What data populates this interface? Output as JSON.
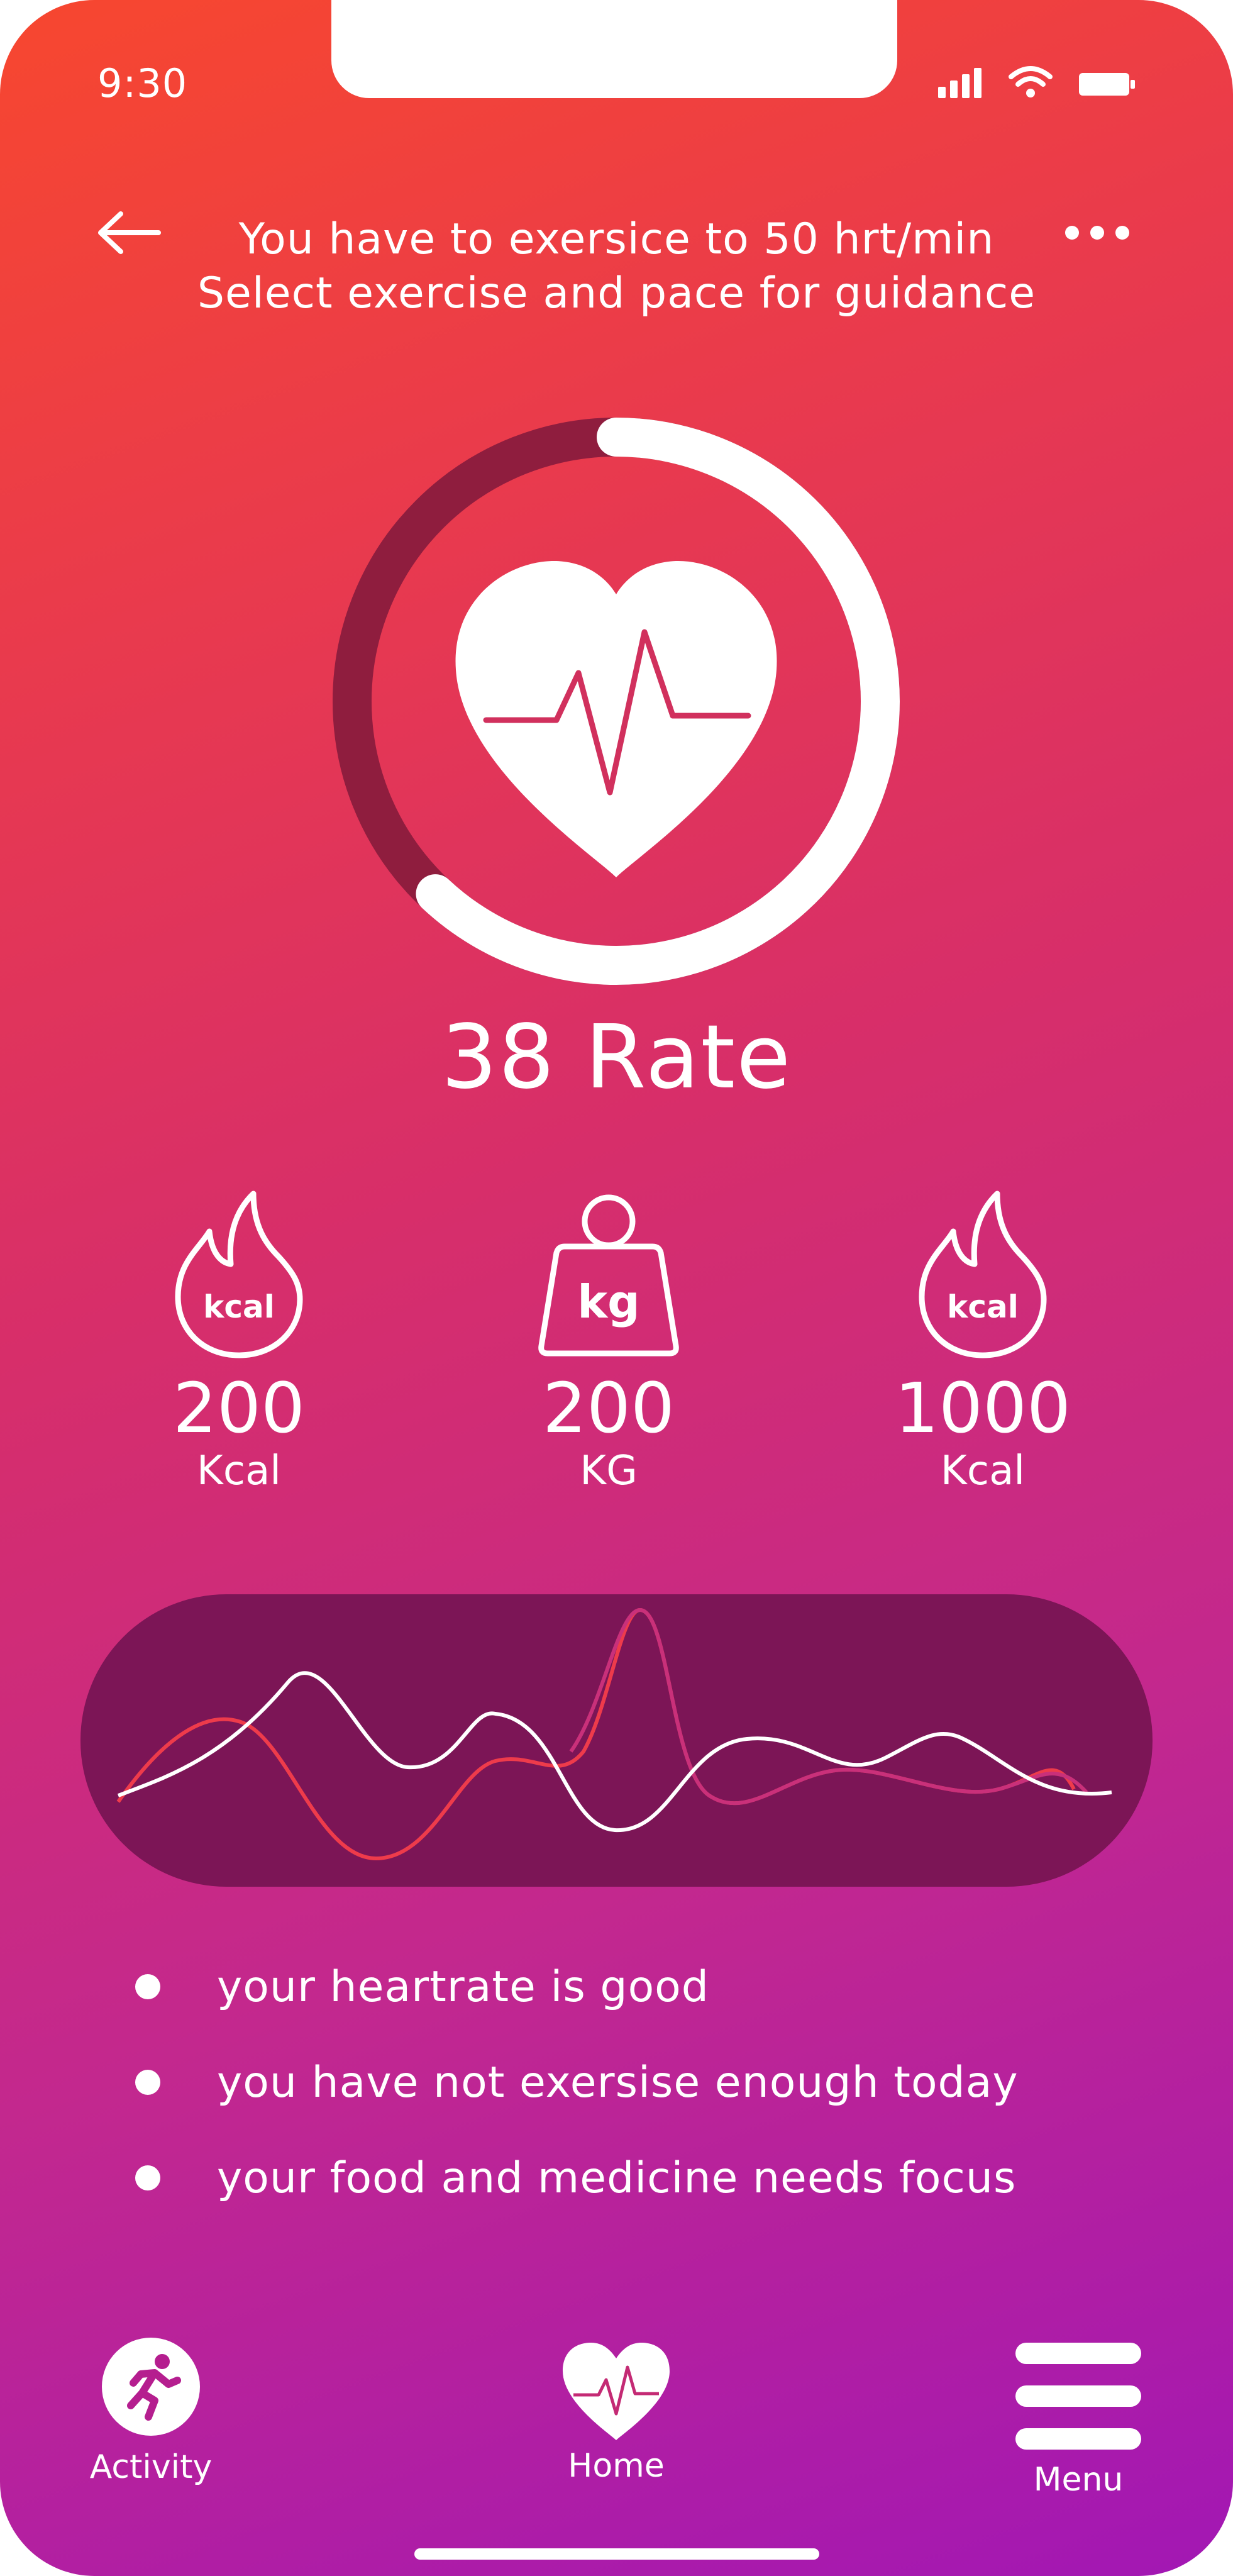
{
  "status_bar": {
    "time": "9:30",
    "icons": [
      "signal-icon",
      "wifi-icon",
      "battery-icon"
    ]
  },
  "header": {
    "line1": "You have to exersice to 50 hrt/min",
    "line2": "Select exercise and pace for guidance",
    "back_icon": "arrow-left-icon",
    "more_icon": "more-dots-icon"
  },
  "heart_rate": {
    "value_label": "38 Rate",
    "progress": 0.62
  },
  "stats": [
    {
      "badge": "kcal",
      "icon": "flame-icon",
      "value": "200",
      "unit": "Kcal"
    },
    {
      "badge": "kg",
      "icon": "weight-icon",
      "value": "200",
      "unit": "KG"
    },
    {
      "badge": "kcal",
      "icon": "flame-icon",
      "value": "1000",
      "unit": "Kcal"
    }
  ],
  "tips": [
    "your heartrate is good",
    "you have not exersise enough today",
    "your food and medicine needs focus"
  ],
  "nav": [
    {
      "label": "Activity",
      "icon": "running-person-icon"
    },
    {
      "label": "Home",
      "icon": "heart-pulse-icon"
    },
    {
      "label": "Menu",
      "icon": "hamburger-menu-icon"
    }
  ],
  "colors": {
    "gradient_top": "#f7472f",
    "gradient_bottom": "#a217b4",
    "wave_panel": "#7c1556",
    "ring_track": "#8f1d3e"
  }
}
